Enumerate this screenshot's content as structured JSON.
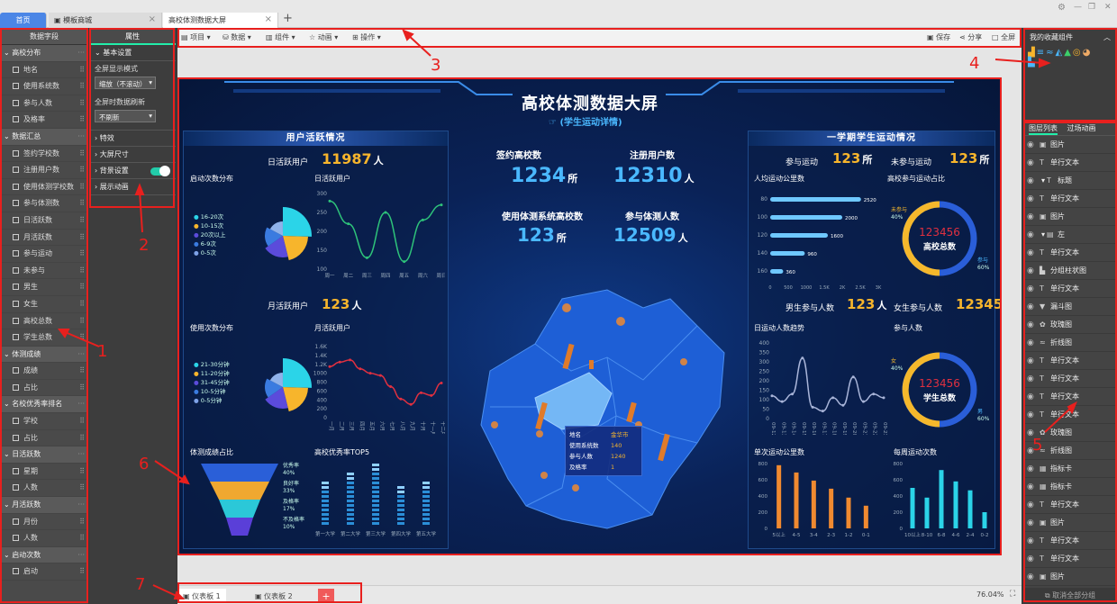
{
  "tabs": {
    "home": "首页",
    "template": "模板商城",
    "active": "高校体测数据大屏",
    "new_tab": "+"
  },
  "window_controls": {
    "settings": "⚙",
    "minimize": "—",
    "restore": "❐",
    "close": "✕"
  },
  "toolbar": {
    "items": [
      "项目",
      "数据",
      "组件",
      "动画",
      "操作"
    ],
    "save": "保存",
    "share": "分享",
    "fullscreen": "全屏"
  },
  "left_panel": {
    "title": "数据字段",
    "groups": [
      {
        "name": "高校分布",
        "items": [
          "地名",
          "使用系统数",
          "参与人数",
          "及格率"
        ]
      },
      {
        "name": "数据汇总",
        "items": [
          "签约学校数",
          "注册用户数",
          "使用体测学校数",
          "参与体测数",
          "日活跃数",
          "月活跃数",
          "参与运动",
          "未参与",
          "男生",
          "女生",
          "高校总数",
          "学生总数"
        ]
      },
      {
        "name": "体测成绩",
        "items": [
          "成绩",
          "占比"
        ]
      },
      {
        "name": "名校优秀率排名",
        "items": [
          "学校",
          "占比"
        ]
      },
      {
        "name": "日活跃数",
        "items": [
          "星期",
          "人数"
        ]
      },
      {
        "name": "月活跃数",
        "items": [
          "月份",
          "人数"
        ]
      },
      {
        "name": "启动次数",
        "items": [
          "启动"
        ]
      }
    ]
  },
  "prop_panel": {
    "title": "属性",
    "basic": "基本设置",
    "fullscreen_mode_label": "全屏显示模式",
    "fullscreen_mode": "缩放（不滚动）",
    "refresh_label": "全屏时数据刷新",
    "refresh": "不刷新",
    "effects": "特效",
    "size": "大屏尺寸",
    "background": "背景设置",
    "animation": "展示动画"
  },
  "dashboard": {
    "title": "高校体测数据大屏",
    "subtitle": "(学生运动详情)",
    "left_panel_title": "用户活跃情况",
    "daily_active_label": "日活跃用户",
    "daily_active_value": "11987",
    "daily_active_unit": "人",
    "launch_dist_title": "启动次数分布",
    "launch_legend": [
      "16-20次",
      "10-15次",
      "20次以上",
      "6-9次",
      "0-5次"
    ],
    "daily_chart_title": "日活跃用户",
    "daily_chart": {
      "type": "line",
      "x": [
        "周一",
        "周二",
        "周三",
        "周四",
        "周五",
        "周六",
        "周日"
      ],
      "ylim": [
        100,
        300
      ],
      "yticks": [
        "300",
        "250",
        "200",
        "150",
        "100"
      ],
      "values": [
        280,
        220,
        130,
        250,
        120,
        230,
        270
      ]
    },
    "monthly_active_label": "月活跃用户",
    "monthly_active_value": "123",
    "monthly_active_unit": "人",
    "usage_dist_title": "使用次数分布",
    "usage_legend": [
      "21-30分钟",
      "11-20分钟",
      "31-45分钟",
      "10-5分钟",
      "0-5分钟"
    ],
    "monthly_chart_title": "月活跃用户",
    "monthly_chart": {
      "type": "line",
      "x": [
        "一月",
        "二月",
        "三月",
        "四月",
        "五月",
        "六月",
        "七月",
        "八月",
        "九月",
        "十月",
        "十一月",
        "十二月"
      ],
      "yticks": [
        "1.6K",
        "1.4K",
        "1.2K",
        "1000",
        "800",
        "600",
        "400",
        "200",
        "0"
      ],
      "values": [
        1150,
        1250,
        1300,
        1100,
        1000,
        950,
        700,
        420,
        300,
        560,
        500,
        780
      ]
    },
    "funnel_title": "体测成绩占比",
    "funnel": [
      {
        "label": "优秀率",
        "pct": "40%"
      },
      {
        "label": "良好率",
        "pct": "33%"
      },
      {
        "label": "及格率",
        "pct": "17%"
      },
      {
        "label": "不及格率",
        "pct": "10%"
      }
    ],
    "top5_title": "高校优秀率TOP5",
    "top5": {
      "type": "bar",
      "categories": [
        "第一大学",
        "第二大学",
        "第三大学",
        "第四大学",
        "第五大学"
      ],
      "values": [
        10,
        12,
        14,
        9,
        10
      ]
    },
    "center": {
      "signed_label": "签约高校数",
      "signed_value": "1234",
      "signed_unit": "所",
      "registered_label": "注册用户数",
      "registered_value": "12310",
      "registered_unit": "人",
      "using_label": "使用体测系统高校数",
      "using_value": "123",
      "using_unit": "所",
      "participants_label": "参与体测人数",
      "participants_value": "12509",
      "participants_unit": "人"
    },
    "map_tooltip": {
      "rows": [
        [
          "地名",
          "金华市"
        ],
        [
          "使用系统数",
          "140"
        ],
        [
          "参与人数",
          "1240"
        ],
        [
          "及格率",
          "1"
        ]
      ]
    },
    "right_panel_title": "一学期学生运动情况",
    "exercise_label": "参与运动",
    "exercise_value": "123",
    "exercise_unit": "所",
    "no_exercise_label": "未参与运动",
    "no_exercise_value": "123",
    "no_exercise_unit": "所",
    "distance_title": "人均运动公里数",
    "distance": {
      "type": "bar",
      "categories": [
        "80",
        "100",
        "120",
        "140",
        "160"
      ],
      "values": [
        2520,
        2000,
        1600,
        960,
        360
      ],
      "xticks": [
        "0",
        "500",
        "1000",
        "1.5K",
        "2K",
        "2.5K",
        "3K"
      ]
    },
    "share_title": "高校参与运动占比",
    "share_donut": {
      "center_label": "高校总数",
      "left_label": "未参与",
      "left_pct": "40%",
      "right_label": "参与",
      "right_pct": "60%"
    },
    "male_label": "男生参与人数",
    "male_value": "123",
    "male_unit": "人",
    "female_label": "女生参与人数",
    "female_value": "12345",
    "female_unit": "人",
    "daily_trend_title": "日运动人数趋势",
    "daily_trend": {
      "type": "line",
      "x": [
        "09-12",
        "09-13",
        "09-14",
        "09-15",
        "09-16",
        "09-17",
        "09-18",
        "09-19",
        "09-20",
        "09-21",
        "09-22",
        "09-23"
      ],
      "yticks": [
        "400",
        "350",
        "300",
        "250",
        "200",
        "150",
        "100",
        "50",
        "0"
      ],
      "values": [
        120,
        90,
        130,
        320,
        60,
        40,
        110,
        70,
        220,
        90,
        130,
        110
      ]
    },
    "participants_title": "参与人数",
    "participants_donut": {
      "center_value": "123456",
      "center_label": "学生总数",
      "left_label": "女",
      "left_pct": "40%",
      "right_label": "男",
      "right_pct": "60%"
    },
    "share_donut_value": "123456",
    "single_distance_title": "单次运动公里数",
    "single_distance": {
      "type": "bar",
      "categories": [
        "5以上",
        "4-5",
        "3-4",
        "2-3",
        "1-2",
        "0-1"
      ],
      "values": [
        780,
        690,
        590,
        490,
        380,
        280
      ],
      "yticks": [
        "800",
        "600",
        "400",
        "200",
        "0"
      ]
    },
    "frequency_title": "每周运动次数",
    "frequency": {
      "type": "bar",
      "categories": [
        "10以上",
        "8-10",
        "6-8",
        "4-6",
        "2-4",
        "0-2"
      ],
      "values": [
        500,
        380,
        720,
        580,
        470,
        200
      ],
      "yticks": [
        "800",
        "600",
        "400",
        "200",
        "0"
      ]
    }
  },
  "favorites": {
    "title": "我的收藏组件"
  },
  "layers": {
    "tab1": "图层列表",
    "tab2": "过场动画",
    "items": [
      "图片",
      "单行文本",
      "标题",
      "单行文本",
      "图片",
      "左",
      "单行文本",
      "分组柱状图",
      "单行文本",
      "漏斗图",
      "玫瑰图",
      "折线图",
      "单行文本",
      "单行文本",
      "单行文本",
      "单行文本",
      "玫瑰图",
      "折线图",
      "指标卡",
      "指标卡",
      "单行文本",
      "图片",
      "单行文本",
      "单行文本",
      "图片"
    ],
    "ungroup": "取消全部分组"
  },
  "bottom": {
    "tab1": "仪表板 1",
    "tab2": "仪表板 2",
    "add": "+",
    "zoom": "76.04%"
  },
  "annotations": [
    "1",
    "2",
    "3",
    "4",
    "5",
    "6",
    "7"
  ],
  "colors": {
    "accent_red": "#e8201e",
    "panel_blue": "#0a2257",
    "orange": "#f7b52c",
    "cyan": "#4ab8ff"
  }
}
